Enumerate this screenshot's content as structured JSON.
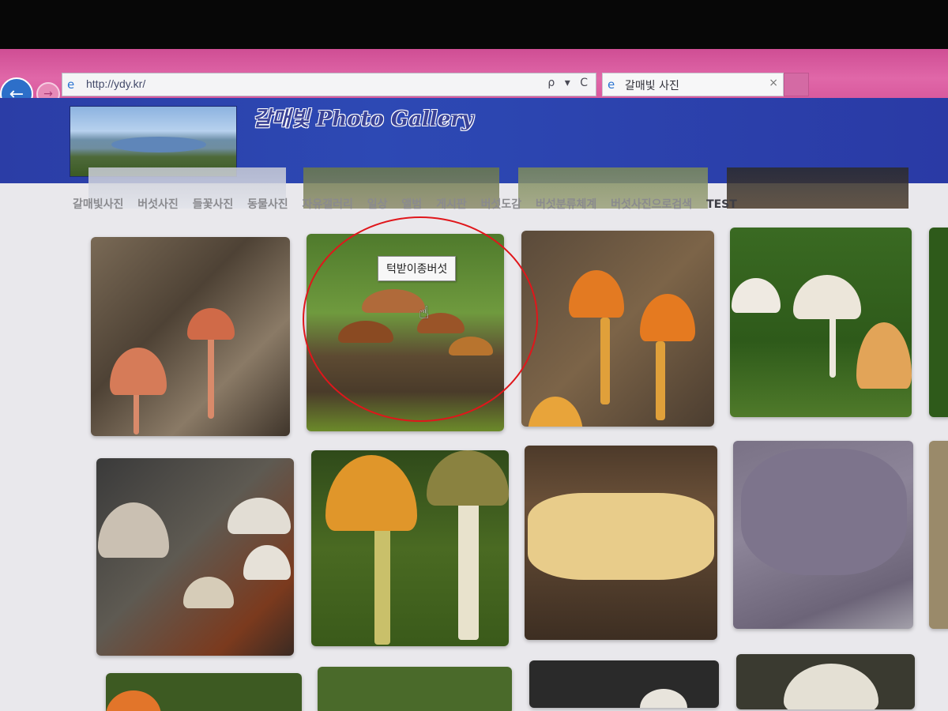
{
  "browser": {
    "url": "http://ydy.kr/",
    "address_controls": "ρ ▾ C",
    "tab_title": "갈매빛 사진",
    "tab_close": "×",
    "back_glyph": "←",
    "forward_glyph": "→",
    "favicon": "e",
    "colors": {
      "chrome": "#d95a9e",
      "back_button": "#2d6fc9"
    }
  },
  "site": {
    "banner_title": "갈매빛 Photo Gallery",
    "banner_color": "#2d49b4"
  },
  "menu": {
    "items": [
      "갈매빛사진",
      "버섯사진",
      "들꽃사진",
      "동물사진",
      "자유갤러리",
      "일상",
      "앨범",
      "게시판",
      "버섯도감",
      "버섯분류체계",
      "버섯사진으로검색",
      "TEST"
    ]
  },
  "gallery": {
    "hover_tooltip": "턱받이종버섯",
    "highlight_color": "#e0161b"
  }
}
